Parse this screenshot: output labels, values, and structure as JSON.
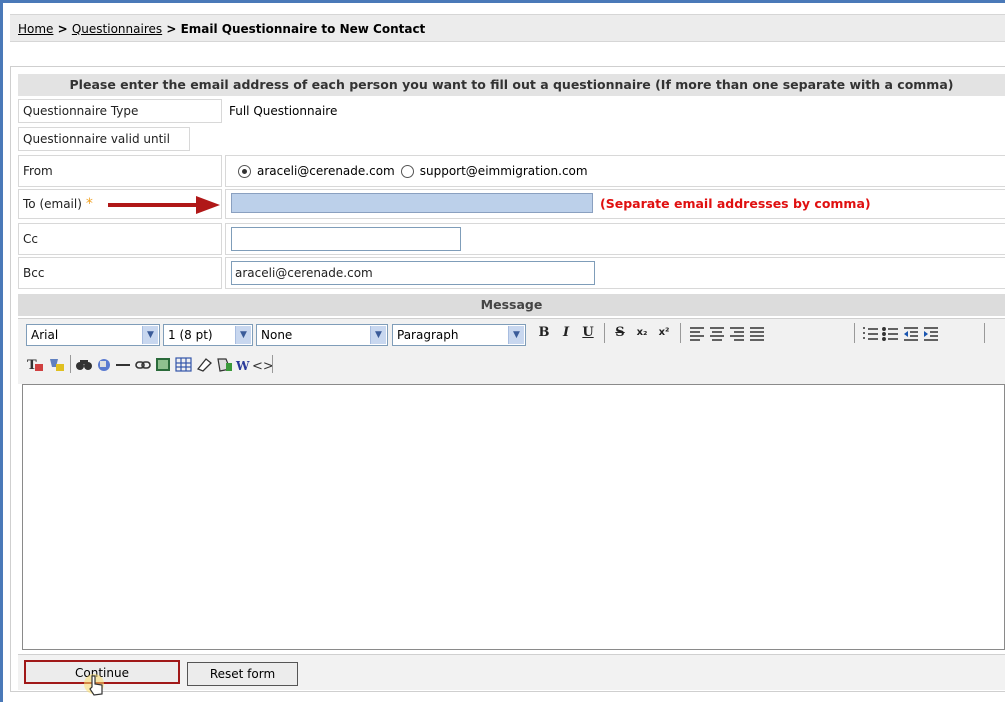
{
  "breadcrumb": {
    "home": "Home",
    "sep1": " > ",
    "questionnaires": "Questionnaires",
    "sep2": " > ",
    "current": "Email Questionnaire to New Contact"
  },
  "instruction": "Please enter the email address of each person you want to fill out a questionnaire (If more than one separate with a comma)",
  "form": {
    "type_label": "Questionnaire Type",
    "type_value": "Full Questionnaire",
    "valid_label": "Questionnaire valid until",
    "from_label": "From",
    "from_options": [
      "araceli@cerenade.com",
      "support@eimmigration.com"
    ],
    "from_selected": "araceli@cerenade.com",
    "to_label": "To (email)",
    "to_required_mark": "*",
    "to_value": "",
    "to_hint": "(Separate email addresses by comma)",
    "cc_label": "Cc",
    "cc_value": "",
    "bcc_label": "Bcc",
    "bcc_value": "araceli@cerenade.com"
  },
  "message": {
    "header": "Message",
    "toolbar": {
      "font": "Arial",
      "size": "1 (8 pt)",
      "style": "None",
      "format": "Paragraph",
      "bold": "B",
      "italic": "I",
      "underline": "U",
      "strike": "S",
      "subscript": "x₂",
      "superscript": "x²"
    }
  },
  "buttons": {
    "continue": "Continue",
    "reset": "Reset form"
  },
  "colors": {
    "hint_red": "#e01010",
    "required_orange": "#f0a020",
    "to_field_fill": "#bcd0ea",
    "arrow_red": "#b01818",
    "frame_blue": "#4a79b8"
  }
}
